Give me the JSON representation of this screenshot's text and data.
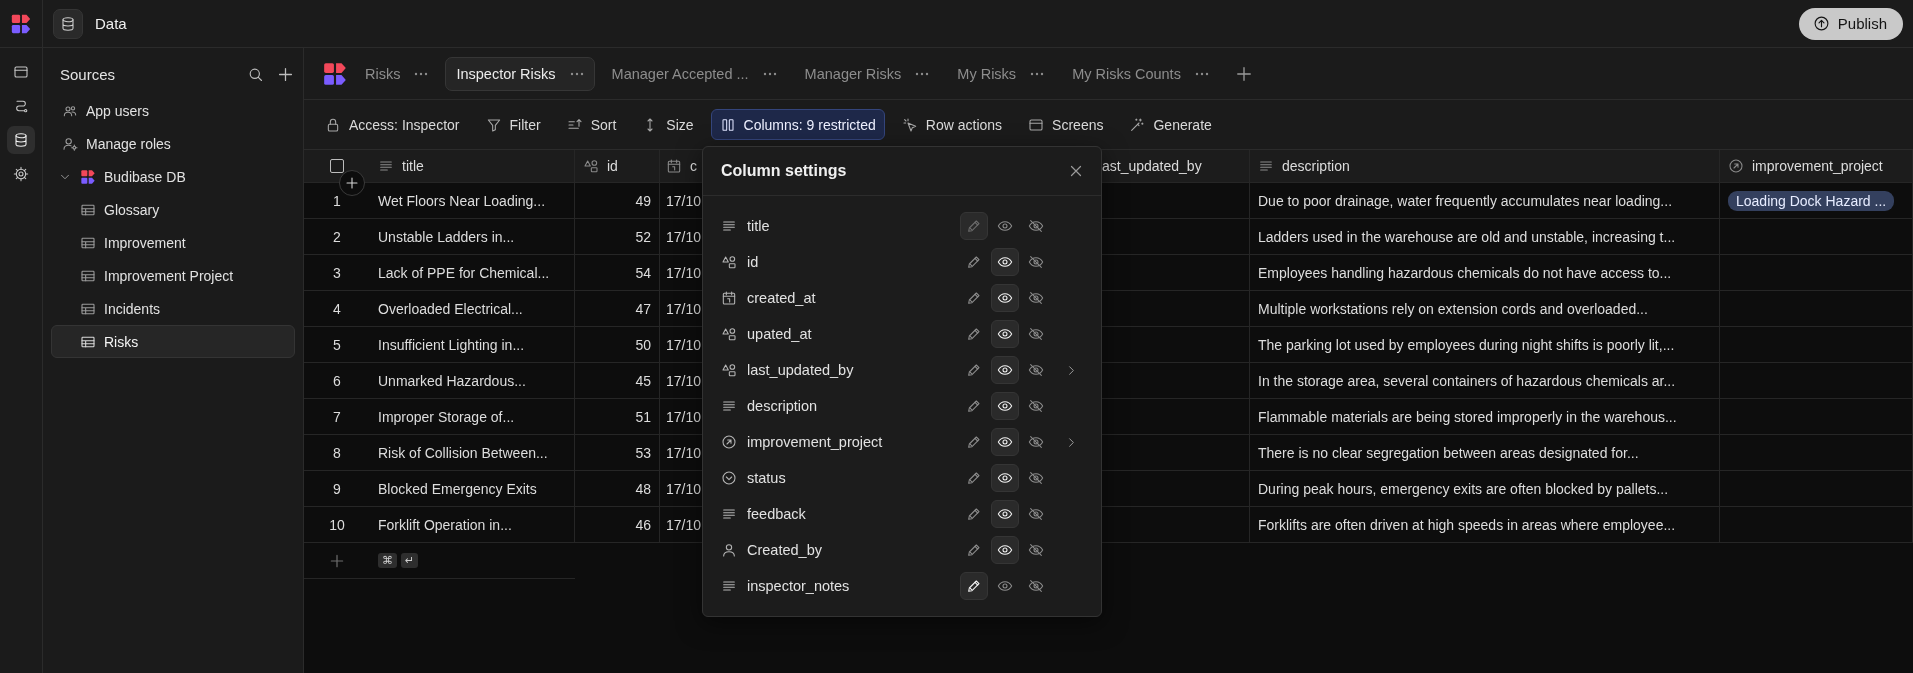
{
  "top_bar": {
    "section": "Data",
    "publish_label": "Publish"
  },
  "nav_rail": [
    {
      "kind": "screens",
      "selected": false
    },
    {
      "kind": "automations",
      "selected": false
    },
    {
      "kind": "data",
      "selected": true
    },
    {
      "kind": "settings",
      "selected": false
    }
  ],
  "sidebar": {
    "title": "Sources",
    "items": [
      {
        "kind": "users",
        "label": "App users",
        "selected": false
      },
      {
        "kind": "roles",
        "label": "Manage roles",
        "selected": false
      },
      {
        "kind": "database",
        "label": "Budibase DB",
        "selected": false,
        "expanded": true,
        "children": [
          {
            "kind": "table",
            "label": "Glossary",
            "selected": false
          },
          {
            "kind": "table",
            "label": "Improvement",
            "selected": false
          },
          {
            "kind": "table",
            "label": "Improvement Project",
            "selected": false
          },
          {
            "kind": "table",
            "label": "Incidents",
            "selected": false
          },
          {
            "kind": "table",
            "label": "Risks",
            "selected": true
          }
        ]
      }
    ]
  },
  "tabs": [
    {
      "label": "Risks",
      "selected": false
    },
    {
      "label": "Inspector Risks",
      "selected": true
    },
    {
      "label": "Manager Accepted ...",
      "selected": false
    },
    {
      "label": "Manager Risks",
      "selected": false
    },
    {
      "label": "My Risks",
      "selected": false
    },
    {
      "label": "My Risks Counts",
      "selected": false
    }
  ],
  "toolbar": [
    {
      "kind": "access",
      "label": "Access: Inspector",
      "active": false
    },
    {
      "kind": "filter",
      "label": "Filter",
      "active": false
    },
    {
      "kind": "sort",
      "label": "Sort",
      "active": false
    },
    {
      "kind": "size",
      "label": "Size",
      "active": false
    },
    {
      "kind": "columns",
      "label": "Columns: 9 restricted",
      "active": true
    },
    {
      "kind": "row_actions",
      "label": "Row actions",
      "active": false
    },
    {
      "kind": "screens",
      "label": "Screens",
      "active": false
    },
    {
      "kind": "generate",
      "label": "Generate",
      "active": false
    }
  ],
  "table": {
    "select_all_checked": false,
    "columns": [
      {
        "kind": "text",
        "label": "title"
      },
      {
        "kind": "auto",
        "label": "id"
      },
      {
        "kind": "date",
        "label": "c"
      },
      {
        "label": "ast_updated_by"
      },
      {
        "kind": "text",
        "label": "description"
      },
      {
        "kind": "link",
        "label": "improvement_project"
      }
    ],
    "rows": [
      {
        "number": "1",
        "title": "Wet Floors Near Loading...",
        "id": "49",
        "created_at": "17/10",
        "description": "Due to poor drainage, water frequently accumulates near loading...",
        "improvement_project": "Loading Dock Hazard ..."
      },
      {
        "number": "2",
        "title": "Unstable Ladders in...",
        "id": "52",
        "created_at": "17/10",
        "description": "Ladders used in the warehouse are old and unstable, increasing t..."
      },
      {
        "number": "3",
        "title": "Lack of PPE for Chemical...",
        "id": "54",
        "created_at": "17/10",
        "description": "Employees handling hazardous chemicals do not have access to..."
      },
      {
        "number": "4",
        "title": "Overloaded Electrical...",
        "id": "47",
        "created_at": "17/10",
        "description": "Multiple workstations rely on extension cords and overloaded..."
      },
      {
        "number": "5",
        "title": "Insufficient Lighting in...",
        "id": "50",
        "created_at": "17/10",
        "description": "The parking lot used by employees during night shifts is poorly lit,..."
      },
      {
        "number": "6",
        "title": "Unmarked Hazardous...",
        "id": "45",
        "created_at": "17/10",
        "description": "In the storage area, several containers of hazardous chemicals ar..."
      },
      {
        "number": "7",
        "title": "Improper Storage of...",
        "id": "51",
        "created_at": "17/10",
        "description": "Flammable materials are being stored improperly in the warehous..."
      },
      {
        "number": "8",
        "title": "Risk of Collision Between...",
        "id": "53",
        "created_at": "17/10",
        "description": "There is no clear segregation between areas designated for..."
      },
      {
        "number": "9",
        "title": "Blocked Emergency Exits",
        "id": "48",
        "created_at": "17/10",
        "description": "During peak hours, emergency exits are often blocked by pallets..."
      },
      {
        "number": "10",
        "title": "Forklift Operation in...",
        "id": "46",
        "created_at": "17/10",
        "description": "Forklifts are often driven at high speeds in areas where employee..."
      }
    ],
    "add_row_keys": [
      "⌘",
      "↵"
    ]
  },
  "column_settings": {
    "title": "Column settings",
    "columns": [
      {
        "kind": "text",
        "label": "title",
        "has_submenu": false,
        "options": [
          {
            "kind": "edit",
            "selected": true,
            "disabled": true
          },
          {
            "kind": "view",
            "selected": false,
            "disabled": false
          },
          {
            "kind": "hide",
            "selected": false,
            "disabled": false
          }
        ]
      },
      {
        "kind": "auto",
        "label": "id",
        "has_submenu": false,
        "options": [
          {
            "kind": "edit",
            "selected": false,
            "disabled": false
          },
          {
            "kind": "view",
            "selected": true,
            "disabled": false
          },
          {
            "kind": "hide",
            "selected": false,
            "disabled": false
          }
        ]
      },
      {
        "kind": "date",
        "label": "created_at",
        "has_submenu": false,
        "options": [
          {
            "kind": "edit",
            "selected": false,
            "disabled": false
          },
          {
            "kind": "view",
            "selected": true,
            "disabled": false
          },
          {
            "kind": "hide",
            "selected": false,
            "disabled": false
          }
        ]
      },
      {
        "kind": "auto",
        "label": "upated_at",
        "has_submenu": false,
        "options": [
          {
            "kind": "edit",
            "selected": false,
            "disabled": false
          },
          {
            "kind": "view",
            "selected": true,
            "disabled": false
          },
          {
            "kind": "hide",
            "selected": false,
            "disabled": false
          }
        ]
      },
      {
        "kind": "auto",
        "label": "last_updated_by",
        "has_submenu": true,
        "options": [
          {
            "kind": "edit",
            "selected": false,
            "disabled": false
          },
          {
            "kind": "view",
            "selected": true,
            "disabled": false
          },
          {
            "kind": "hide",
            "selected": false,
            "disabled": false
          }
        ]
      },
      {
        "kind": "text",
        "label": "description",
        "has_submenu": false,
        "options": [
          {
            "kind": "edit",
            "selected": false,
            "disabled": false
          },
          {
            "kind": "view",
            "selected": true,
            "disabled": false
          },
          {
            "kind": "hide",
            "selected": false,
            "disabled": false
          }
        ]
      },
      {
        "kind": "link",
        "label": "improvement_project",
        "has_submenu": true,
        "options": [
          {
            "kind": "edit",
            "selected": false,
            "disabled": false
          },
          {
            "kind": "view",
            "selected": true,
            "disabled": false
          },
          {
            "kind": "hide",
            "selected": false,
            "disabled": false
          }
        ]
      },
      {
        "kind": "options",
        "label": "status",
        "has_submenu": false,
        "options": [
          {
            "kind": "edit",
            "selected": false,
            "disabled": false
          },
          {
            "kind": "view",
            "selected": true,
            "disabled": false
          },
          {
            "kind": "hide",
            "selected": false,
            "disabled": false
          }
        ]
      },
      {
        "kind": "text",
        "label": "feedback",
        "has_submenu": false,
        "options": [
          {
            "kind": "edit",
            "selected": false,
            "disabled": false
          },
          {
            "kind": "view",
            "selected": true,
            "disabled": false
          },
          {
            "kind": "hide",
            "selected": false,
            "disabled": false
          }
        ]
      },
      {
        "kind": "user",
        "label": "Created_by",
        "has_submenu": false,
        "options": [
          {
            "kind": "edit",
            "selected": false,
            "disabled": false
          },
          {
            "kind": "view",
            "selected": true,
            "disabled": false
          },
          {
            "kind": "hide",
            "selected": false,
            "disabled": false
          }
        ]
      },
      {
        "kind": "text",
        "label": "inspector_notes",
        "has_submenu": false,
        "options": [
          {
            "kind": "edit",
            "selected": true,
            "disabled": false
          },
          {
            "kind": "view",
            "selected": false,
            "disabled": false
          },
          {
            "kind": "hide",
            "selected": false,
            "disabled": false
          }
        ]
      }
    ]
  }
}
